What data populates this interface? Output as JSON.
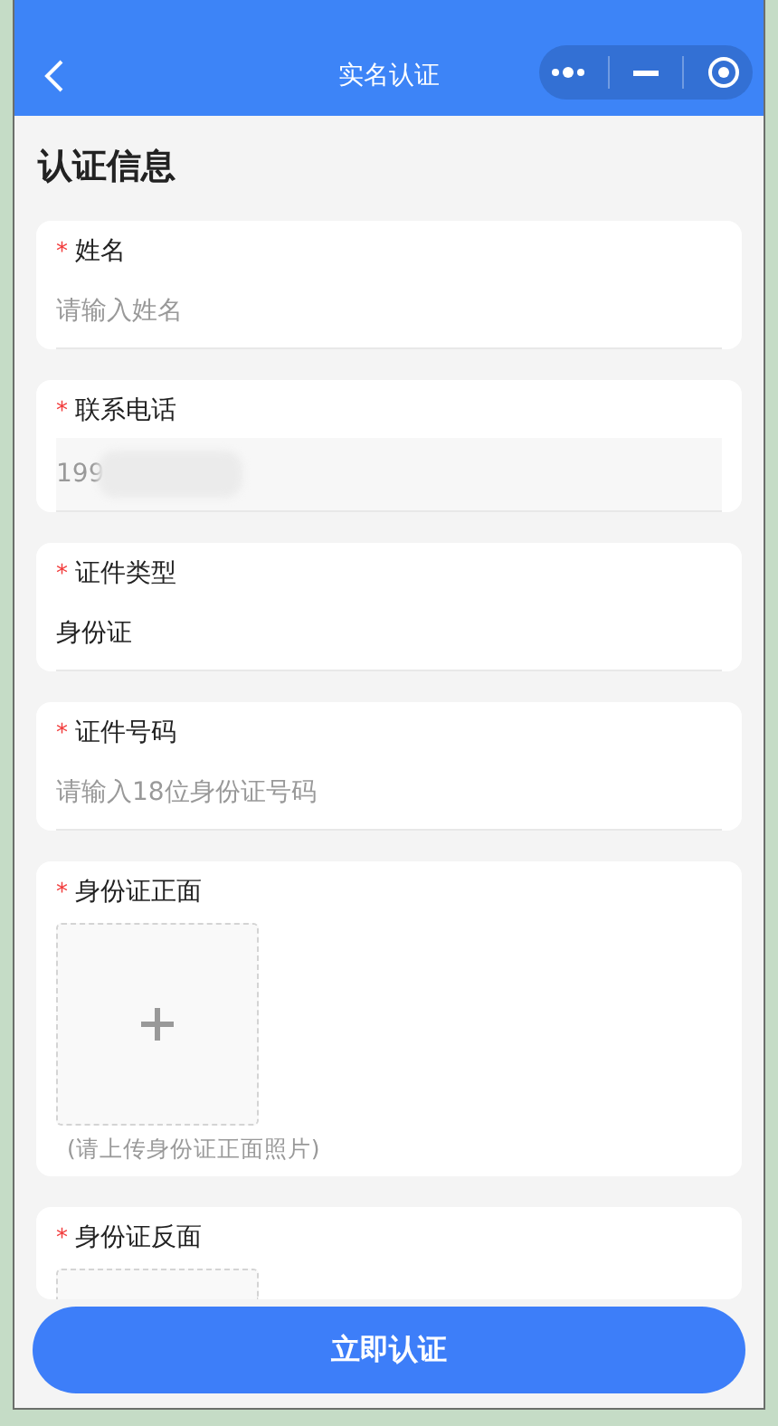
{
  "nav_bar": {
    "title": "实名认证"
  },
  "section_title": "认证信息",
  "fields": [
    {
      "kind": "input",
      "mark": "*",
      "label": "姓名",
      "placeholder": "请输入姓名"
    },
    {
      "kind": "masked",
      "mark": "*",
      "label": "联系电话",
      "value": "199",
      "disabled": true
    },
    {
      "kind": "input",
      "mark": "*",
      "label": "证件类型",
      "value": "身份证"
    },
    {
      "kind": "input",
      "mark": "*",
      "label": "证件号码",
      "placeholder": "请输入18位身份证号码"
    },
    {
      "kind": "upload",
      "mark": "*",
      "label": "身份证正面",
      "hint": "(请上传身份证正面照片)"
    },
    {
      "kind": "upload",
      "mark": "*",
      "label": "身份证反面"
    }
  ],
  "submit_button": "立即认证"
}
